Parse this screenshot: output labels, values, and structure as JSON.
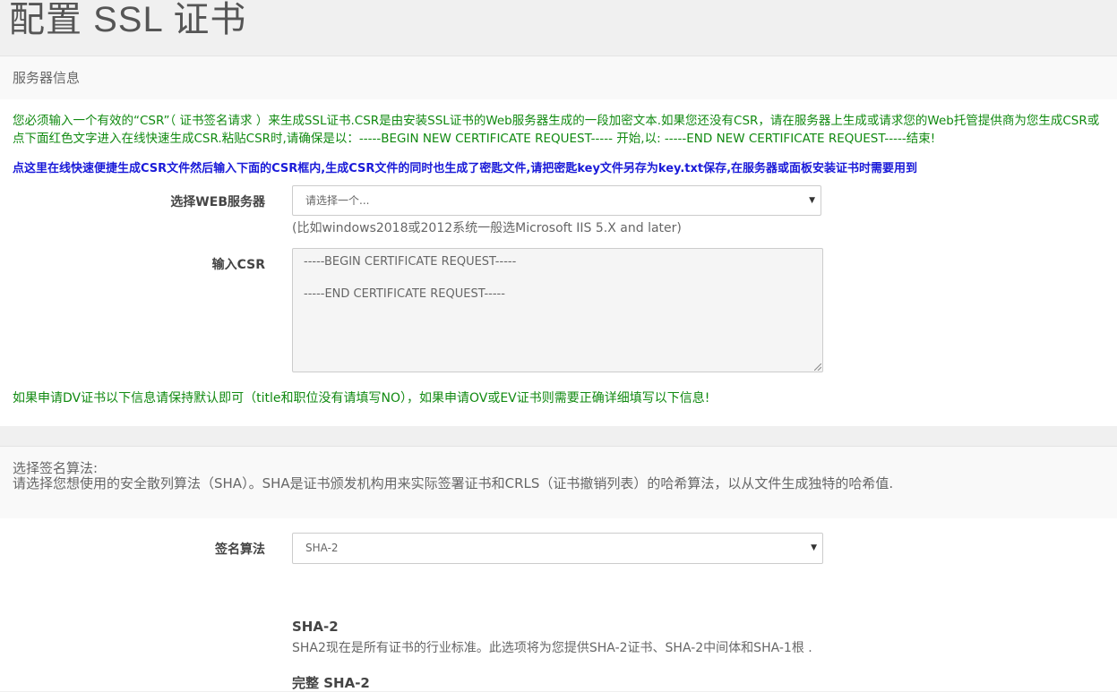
{
  "page": {
    "title": "配置 SSL 证书"
  },
  "server_info": {
    "header": "服务器信息",
    "notice": "您必须输入一个有效的“CSR”（ 证书签名请求 ）来生成SSL证书.CSR是由安装SSL证书的Web服务器生成的一段加密文本.如果您还没有CSR，请在服务器上生成或请求您的Web托管提供商为您生成CSR或点下面红色文字进入在线快速生成CSR.粘贴CSR时,请确保是以：-----BEGIN NEW CERTIFICATE REQUEST----- 开始,以: -----END NEW CERTIFICATE REQUEST-----结束!",
    "generate_link": "点这里在线快速便捷生成CSR文件然后输入下面的CSR框内,生成CSR文件的同时也生成了密匙文件,请把密匙key文件另存为key.txt保存,在服务器或面板安装证书时需要用到",
    "web_server_label": "选择WEB服务器",
    "web_server_value": "请选择一个...",
    "web_server_hint": "(比如windows2018或2012系统一般选Microsoft IIS 5.X and later)",
    "csr_label": "输入CSR",
    "csr_value": "-----BEGIN CERTIFICATE REQUEST-----\n\n-----END CERTIFICATE REQUEST-----",
    "dv_note": "如果申请DV证书以下信息请保持默认即可（title和职位没有请填写NO），如果申请OV或EV证书则需要正确详细填写以下信息!"
  },
  "signature": {
    "header": "选择签名算法:",
    "description": "请选择您想使用的安全散列算法（SHA）。SHA是证书颁发机构用来实际签署证书和CRLS（证书撤销列表）的哈希算法，以从文件生成独特的哈希值.",
    "label": "签名算法",
    "value": "SHA-2",
    "options": [
      {
        "title": "SHA-2",
        "desc": "SHA2现在是所有证书的行业标准。此选项将为您提供SHA-2证书、SHA-2中间体和SHA-1根 ."
      },
      {
        "title": "完整 SHA-2",
        "desc": ""
      }
    ]
  },
  "colors": {
    "green_text": "#118a11",
    "blue_link": "#1a1ad8"
  },
  "icons": {
    "caret": "caret-down-icon",
    "grip": "resize-grip-icon"
  }
}
